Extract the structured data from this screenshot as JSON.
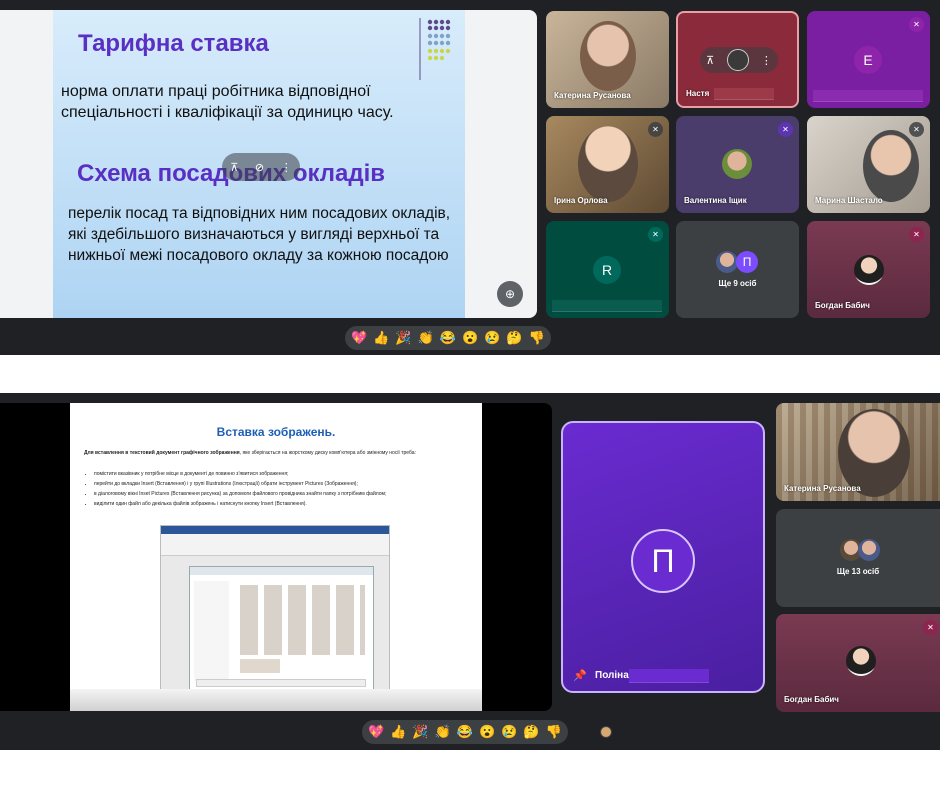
{
  "panel1": {
    "slide": {
      "title1": "Тарифна ставка",
      "text1": "норма оплати праці робітника відповідної спеціальності і кваліфікації за одиницю часу.",
      "title2": "Схема посадових окладів",
      "text2": "перелік посад та відповідних ним посадових окладів, які здебільшого визначаються у вигляді верхньої та нижньої межі посадового окладу за кожною посадою"
    },
    "tiles": [
      {
        "name": "Катерина Русанова"
      },
      {
        "name": "Настя"
      },
      {
        "name": "",
        "initial": "E"
      },
      {
        "name": "Ірина Орлова"
      },
      {
        "name": "Валентина Іщик"
      },
      {
        "name": "Марина Шастало"
      },
      {
        "name": "",
        "initial": "R"
      },
      {
        "name": "Ще 9 осіб",
        "initial": "П"
      },
      {
        "name": "Богдан Бабич"
      }
    ],
    "reactions": [
      "💖",
      "👍",
      "🎉",
      "👏",
      "😂",
      "😮",
      "😢",
      "🤔",
      "👎"
    ]
  },
  "panel2": {
    "slide": {
      "title": "Вставка зображень.",
      "intro_bold": "Для вставлення в текстовий документ графічного зображення",
      "intro_rest": ", яке зберігається на жорсткому диску комп'ютера або змінному носії треба:",
      "bullets": [
        "помістити вказівник у потрібне місце в документі де повинно з'явитися зображення;",
        "перейти до вкладки Insert (Вставлення) і у групі Illustrations (Ілюстрації) обрати інструмент Pictures (Зображення);",
        "в діалоговому вікні Inset Pictures (Вставлення рисунка) за допомоги файлового провідника знайти папку з потрібним файлом;",
        "виділити один файл або декілька файлів зображень і натиснути кнопку Insert (Вставлення)."
      ]
    },
    "main_tile": {
      "initial": "П",
      "name": "Поліна"
    },
    "tiles": [
      {
        "name": "Катерина Русанова"
      },
      {
        "name": "Ще 13 осіб"
      },
      {
        "name": "Богдан Бабич"
      }
    ],
    "reactions": [
      "💖",
      "👍",
      "🎉",
      "👏",
      "😂",
      "😮",
      "😢",
      "🤔",
      "👎"
    ]
  }
}
